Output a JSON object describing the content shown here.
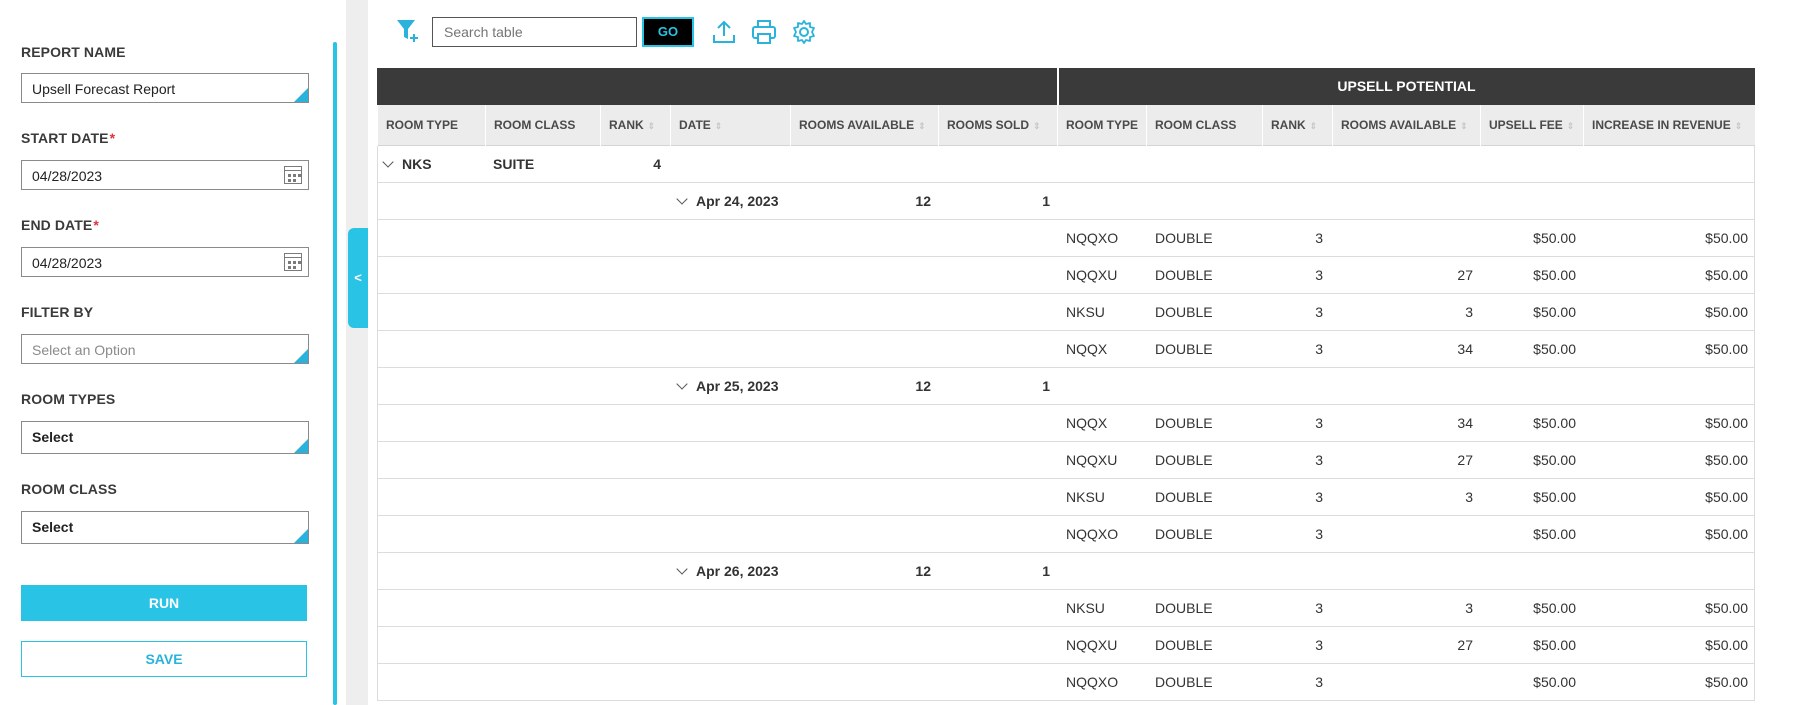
{
  "sidebar": {
    "report_name_label": "REPORT NAME",
    "report_name_value": "Upsell Forecast Report",
    "start_date_label": "START DATE",
    "start_date_value": "04/28/2023",
    "end_date_label": "END DATE",
    "end_date_value": "04/28/2023",
    "required_mark": "*",
    "filter_by_label": "FILTER BY",
    "filter_by_placeholder": "Select an Option",
    "room_types_label": "ROOM TYPES",
    "room_types_value": "Select",
    "room_class_label": "ROOM CLASS",
    "room_class_value": "Select",
    "run_label": "RUN",
    "save_label": "SAVE",
    "collapse_label": "<"
  },
  "toolbar": {
    "search_placeholder": "Search table",
    "go_label": "GO",
    "icons": [
      "filter-add-icon",
      "upload-icon",
      "print-icon",
      "gear-icon"
    ]
  },
  "colors": {
    "accent": "#29c3e5",
    "header_dark": "#3a3a3a",
    "required": "#e0323c"
  },
  "table": {
    "group_header": "UPSELL POTENTIAL",
    "columns": [
      "ROOM TYPE",
      "ROOM CLASS",
      "RANK",
      "DATE",
      "ROOMS AVAILABLE",
      "ROOMS SOLD",
      "ROOM TYPE",
      "ROOM CLASS",
      "RANK",
      "ROOMS AVAILABLE",
      "UPSELL FEE",
      "INCREASE IN REVENUE"
    ],
    "group": {
      "room_type": "NKS",
      "room_class": "SUITE",
      "rank": "4"
    },
    "dates": [
      {
        "date": "Apr 24, 2023",
        "rooms_available": "12",
        "rooms_sold": "1",
        "rows": [
          {
            "room_type": "NQQXO",
            "room_class": "DOUBLE",
            "rank": "3",
            "rooms_available": "",
            "upsell_fee": "$50.00",
            "increase": "$50.00"
          },
          {
            "room_type": "NQQXU",
            "room_class": "DOUBLE",
            "rank": "3",
            "rooms_available": "27",
            "upsell_fee": "$50.00",
            "increase": "$50.00"
          },
          {
            "room_type": "NKSU",
            "room_class": "DOUBLE",
            "rank": "3",
            "rooms_available": "3",
            "upsell_fee": "$50.00",
            "increase": "$50.00"
          },
          {
            "room_type": "NQQX",
            "room_class": "DOUBLE",
            "rank": "3",
            "rooms_available": "34",
            "upsell_fee": "$50.00",
            "increase": "$50.00"
          }
        ]
      },
      {
        "date": "Apr 25, 2023",
        "rooms_available": "12",
        "rooms_sold": "1",
        "rows": [
          {
            "room_type": "NQQX",
            "room_class": "DOUBLE",
            "rank": "3",
            "rooms_available": "34",
            "upsell_fee": "$50.00",
            "increase": "$50.00"
          },
          {
            "room_type": "NQQXU",
            "room_class": "DOUBLE",
            "rank": "3",
            "rooms_available": "27",
            "upsell_fee": "$50.00",
            "increase": "$50.00"
          },
          {
            "room_type": "NKSU",
            "room_class": "DOUBLE",
            "rank": "3",
            "rooms_available": "3",
            "upsell_fee": "$50.00",
            "increase": "$50.00"
          },
          {
            "room_type": "NQQXO",
            "room_class": "DOUBLE",
            "rank": "3",
            "rooms_available": "",
            "upsell_fee": "$50.00",
            "increase": "$50.00"
          }
        ]
      },
      {
        "date": "Apr 26, 2023",
        "rooms_available": "12",
        "rooms_sold": "1",
        "rows": [
          {
            "room_type": "NKSU",
            "room_class": "DOUBLE",
            "rank": "3",
            "rooms_available": "3",
            "upsell_fee": "$50.00",
            "increase": "$50.00"
          },
          {
            "room_type": "NQQXU",
            "room_class": "DOUBLE",
            "rank": "3",
            "rooms_available": "27",
            "upsell_fee": "$50.00",
            "increase": "$50.00"
          },
          {
            "room_type": "NQQXO",
            "room_class": "DOUBLE",
            "rank": "3",
            "rooms_available": "",
            "upsell_fee": "$50.00",
            "increase": "$50.00"
          }
        ]
      }
    ]
  }
}
